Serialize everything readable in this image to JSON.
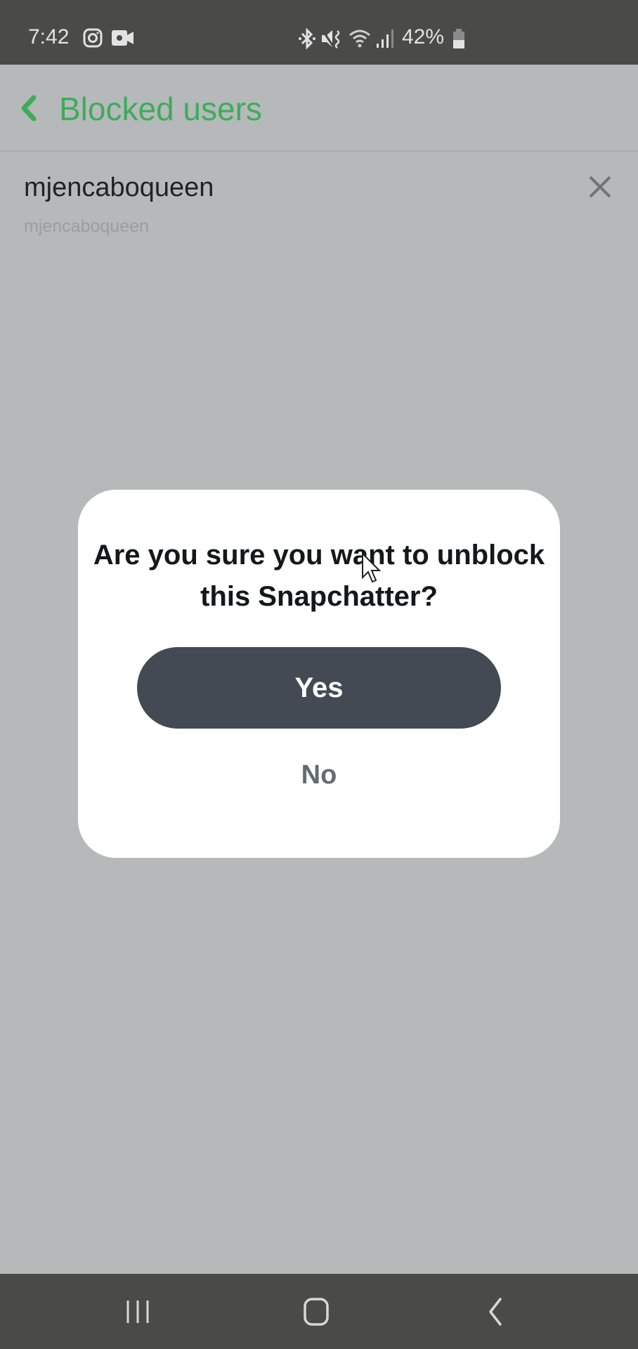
{
  "status_bar": {
    "time": "7:42",
    "left_icons": [
      "instagram-icon",
      "video-camera-icon"
    ],
    "right_icons": [
      "bluetooth-icon",
      "mute-icon",
      "wifi-icon",
      "signal-icon"
    ],
    "battery_percent": "42%"
  },
  "header": {
    "back_icon": "chevron-left-icon",
    "title": "Blocked users",
    "accent_color": "#3fab5a"
  },
  "blocked_list": [
    {
      "display_name": "mjencaboqueen",
      "username": "mjencaboqueen",
      "remove_icon": "close-icon"
    }
  ],
  "dialog": {
    "question": "Are you sure you want to unblock this Snapchatter?",
    "yes_label": "Yes",
    "no_label": "No",
    "yes_color": "#434a54"
  },
  "nav_bar": {
    "buttons": [
      "recent-apps-icon",
      "home-icon",
      "back-icon"
    ]
  }
}
